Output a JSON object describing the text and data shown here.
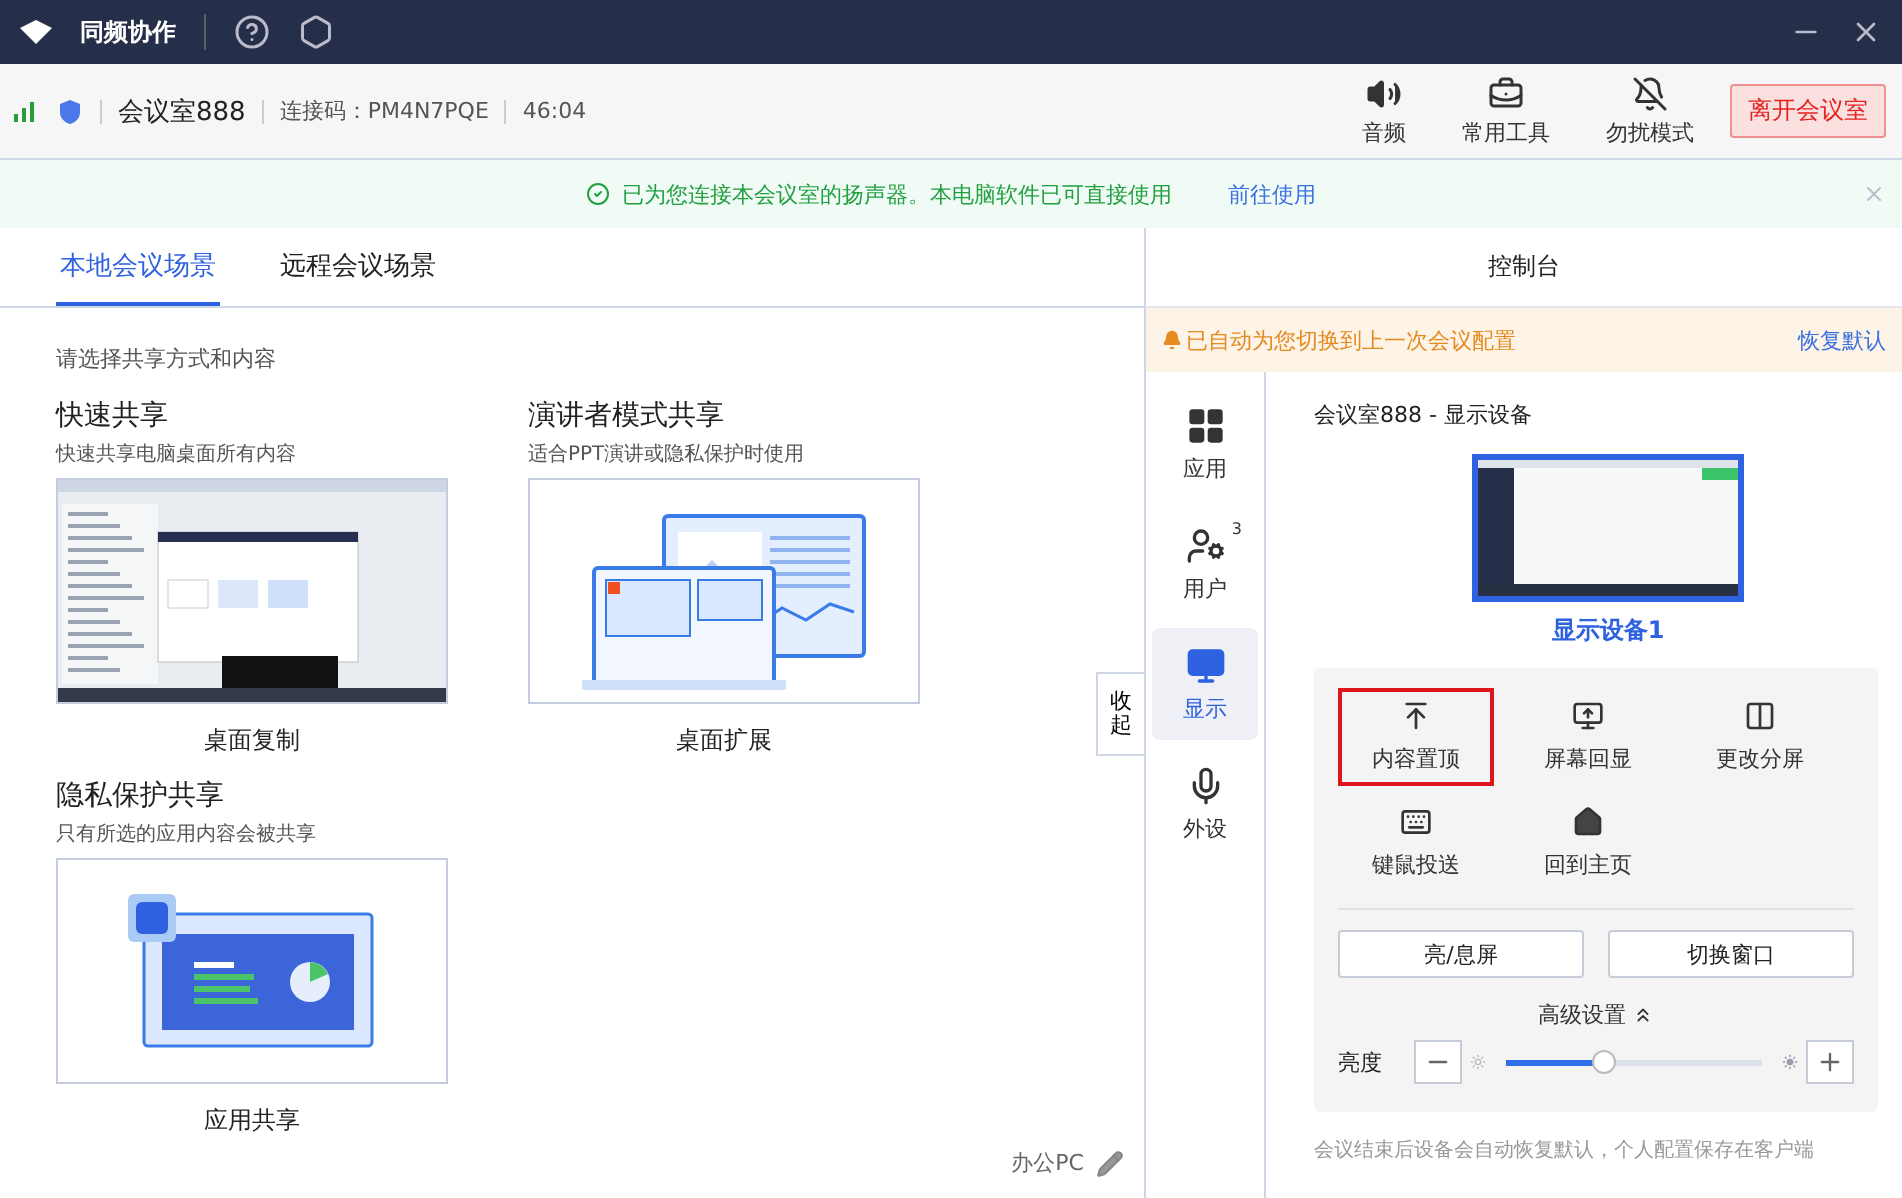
{
  "window": {
    "title": "同频协作"
  },
  "info_bar": {
    "room": "会议室888",
    "code": "连接码：PM4N7PQE",
    "duration": "46:04",
    "tools": [
      {
        "kind": "audio",
        "label": "音频"
      },
      {
        "kind": "tools",
        "label": "常用工具"
      },
      {
        "kind": "dnd",
        "label": "勿扰模式"
      }
    ],
    "leave_button": "离开会议室"
  },
  "notice": {
    "text": "已为您连接本会议室的扬声器。本电脑软件已可直接使用",
    "link": "前往使用"
  },
  "tabs": [
    {
      "label": "本地会议场景",
      "selected": true
    },
    {
      "label": "远程会议场景",
      "selected": false
    }
  ],
  "prompt": "请选择共享方式和内容",
  "share_modes": [
    {
      "kind": "desktop",
      "title": "快速共享",
      "description": "快速共享电脑桌面所有内容",
      "caption": "桌面复制"
    },
    {
      "kind": "presenter",
      "title": "演讲者模式共享",
      "description": "适合PPT演讲或隐私保护时使用",
      "caption": "桌面扩展"
    },
    {
      "kind": "app",
      "title": "隐私保护共享",
      "description": "只有所选的应用内容会被共享",
      "caption": "应用共享"
    }
  ],
  "collapse_tab": "收起",
  "device_name": "办公PC",
  "console": {
    "title": "控制台",
    "alert": "已自动为您切换到上一次会议配置",
    "restore_link": "恢复默认",
    "nav": [
      {
        "kind": "apps",
        "label": "应用",
        "selected": false
      },
      {
        "kind": "users",
        "label": "用户",
        "badge": "3",
        "selected": false
      },
      {
        "kind": "display",
        "label": "显示",
        "selected": true
      },
      {
        "kind": "peripherals",
        "label": "外设",
        "selected": false
      }
    ],
    "section_title": "会议室888 - 显示设备",
    "device_label": "显示设备1",
    "actions": [
      {
        "kind": "pin",
        "label": "内容置顶",
        "highlighted": true
      },
      {
        "kind": "mirror",
        "label": "屏幕回显",
        "highlighted": false
      },
      {
        "kind": "split",
        "label": "更改分屏",
        "highlighted": false
      },
      {
        "kind": "keyboard",
        "label": "键鼠投送",
        "highlighted": false
      },
      {
        "kind": "home",
        "label": "回到主页",
        "highlighted": false
      }
    ],
    "buttons": [
      "亮/息屏",
      "切换窗口"
    ],
    "advanced": "高级设置",
    "brightness": {
      "label": "亮度",
      "level": 0.38
    },
    "footer": "会议结束后设备会自动恢复默认，个人配置保存在客户端"
  }
}
